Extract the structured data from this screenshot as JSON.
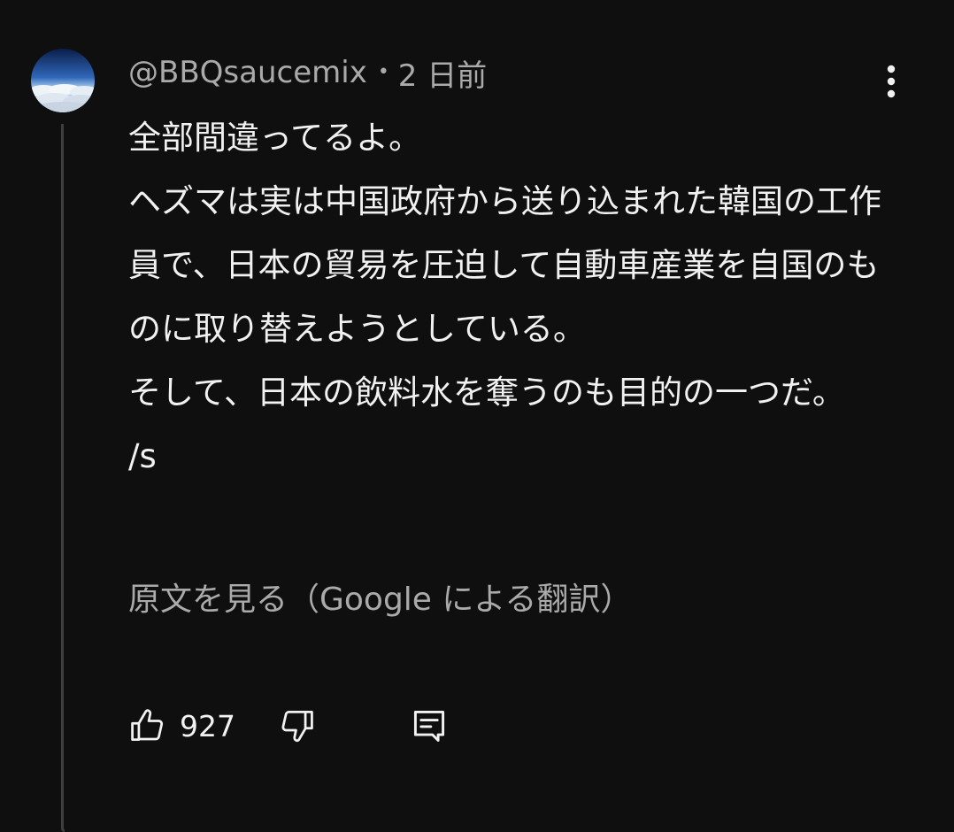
{
  "comment": {
    "author": "@BBQsaucemix",
    "separator": "•",
    "timestamp": "2 日前",
    "body": "全部間違ってるよ。\nヘズマは実は中国政府から送り込まれた韓国の工作員で、日本の貿易を圧迫して自動車産業を自国のものに取り替えようとしている。\nそして、日本の飲料水を奪うのも目的の一つだ。\n/s",
    "translate_label": "原文を見る（Google による翻訳）",
    "like_count": "927"
  },
  "icons": {
    "avatar": "sky-clouds-avatar",
    "menu": "more-vertical-icon",
    "like": "thumbs-up-icon",
    "dislike": "thumbs-down-icon",
    "reply": "reply-comment-icon"
  },
  "colors": {
    "background": "#0f0f0f",
    "text_primary": "#f1f1f1",
    "text_secondary": "#aaaaaa",
    "thread_line": "#3e3e3e"
  }
}
